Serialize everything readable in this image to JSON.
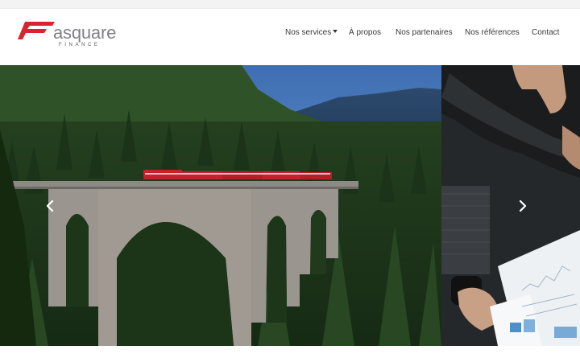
{
  "brand": {
    "name": "asquare",
    "tagline": "FINANCE",
    "accent_color": "#d9232d"
  },
  "nav": {
    "items": [
      {
        "label": "Nos services",
        "has_dropdown": true
      },
      {
        "label": "À propos"
      },
      {
        "label": "Nos partenaires"
      },
      {
        "label": "Nos références"
      },
      {
        "label": "Contact"
      }
    ]
  },
  "carousel": {
    "prev_icon": "chevron-left-icon",
    "next_icon": "chevron-right-icon",
    "slides": [
      {
        "image": "railway-viaduct-photo"
      },
      {
        "image": "business-documents-photo"
      }
    ]
  }
}
